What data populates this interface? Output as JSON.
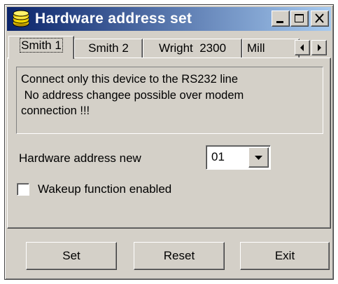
{
  "window": {
    "title": "Hardware address set",
    "icon": "database-coins-icon",
    "controls": [
      "minimize-icon",
      "maximize-icon",
      "close-icon"
    ]
  },
  "tabs": [
    {
      "label": "Smith 1",
      "active": true
    },
    {
      "label": "Smith 2",
      "active": false
    },
    {
      "label": "Wright  2300",
      "active": false
    },
    {
      "label": "Mill",
      "active": false
    }
  ],
  "tab_scroll": {
    "left": "scroll-left-icon",
    "right": "scroll-right-icon"
  },
  "info": {
    "line1": "Connect only this device  to the RS232 line",
    "line2": " No address changee possible over modem",
    "line3": "connection !!!"
  },
  "hardware_address": {
    "label": "Hardware address new",
    "value": "01"
  },
  "wakeup": {
    "label": "Wakeup function enabled",
    "checked": false
  },
  "buttons": {
    "set": "Set",
    "reset": "Reset",
    "exit": "Exit"
  }
}
